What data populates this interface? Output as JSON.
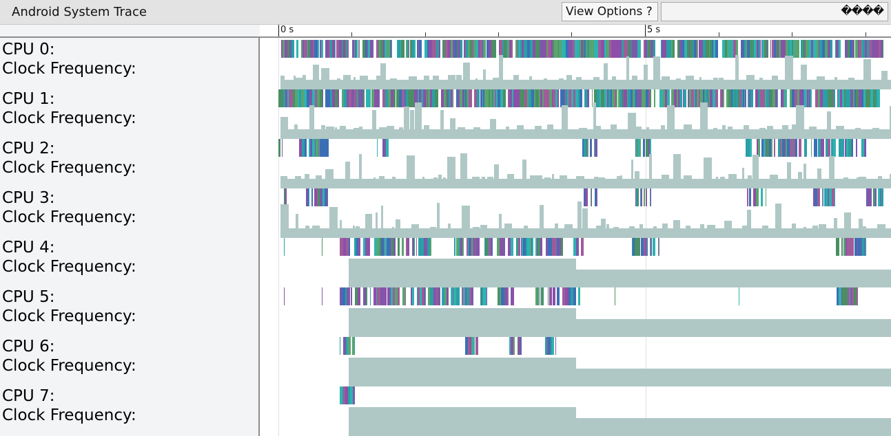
{
  "header": {
    "title": "Android System Trace",
    "view_options_label": "View Options ?",
    "search_value": "",
    "search_glyphs": "����"
  },
  "ruler": {
    "ticks": [
      {
        "label": "0 s"
      },
      {
        "label": "5 s"
      }
    ]
  },
  "rows": [
    {
      "cpu_label": "CPU 0:",
      "freq_label": "Clock Frequency:"
    },
    {
      "cpu_label": "CPU 1:",
      "freq_label": "Clock Frequency:"
    },
    {
      "cpu_label": "CPU 2:",
      "freq_label": "Clock Frequency:"
    },
    {
      "cpu_label": "CPU 3:",
      "freq_label": "Clock Frequency:"
    },
    {
      "cpu_label": "CPU 4:",
      "freq_label": "Clock Frequency:"
    },
    {
      "cpu_label": "CPU 5:",
      "freq_label": "Clock Frequency:"
    },
    {
      "cpu_label": "CPU 6:",
      "freq_label": "Clock Frequency:"
    },
    {
      "cpu_label": "CPU 7:",
      "freq_label": "Clock Frequency:"
    }
  ],
  "colors": {
    "freq_fill": "#afc8c6",
    "slice_palette": [
      "#2a9fa7",
      "#4a8f63",
      "#7a5aa8",
      "#3b6fb5",
      "#2fb3b0",
      "#8e4fa8",
      "#5aa46f",
      "#a05c9a"
    ]
  }
}
